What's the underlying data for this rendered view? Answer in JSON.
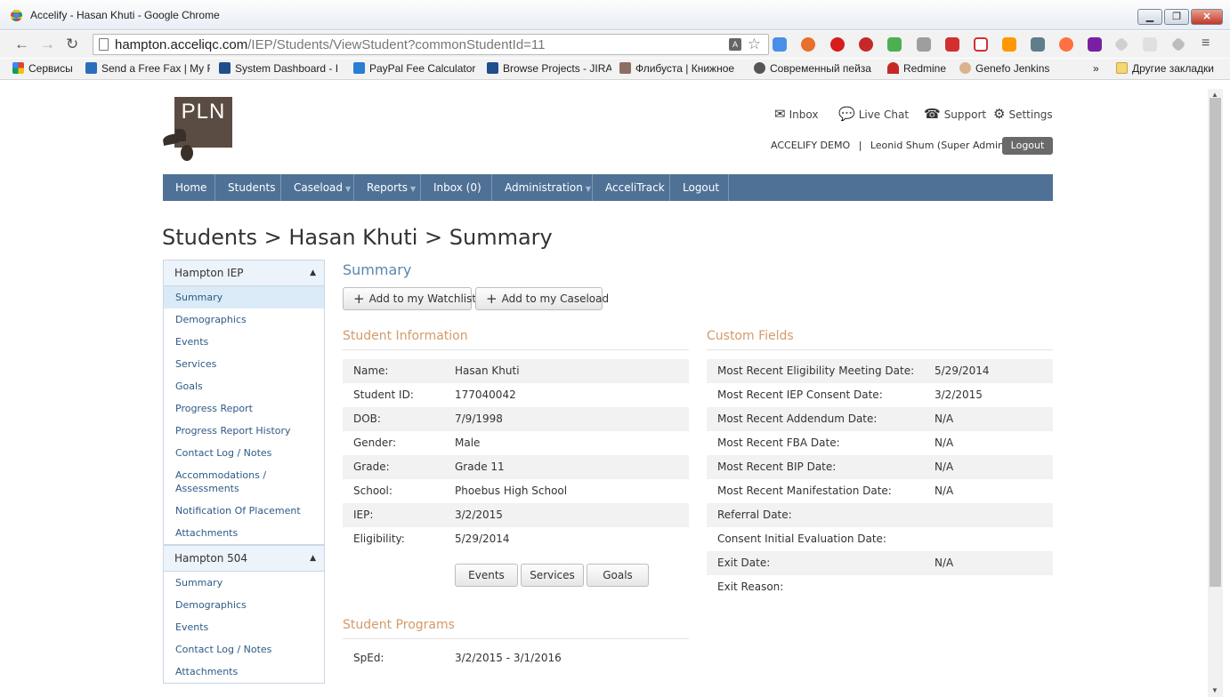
{
  "window": {
    "title": "Accelify - Hasan Khuti - Google Chrome",
    "minimize_label": "▁",
    "restore_label": "❐",
    "close_label": "✕"
  },
  "toolbar": {
    "url_host": "hampton.acceliqc.com",
    "url_path": "/IEP/Students/ViewStudent?commonStudentId=11"
  },
  "bookmarks": [
    {
      "label": "Сервисы"
    },
    {
      "label": "Send a Free Fax | My F"
    },
    {
      "label": "System Dashboard - I"
    },
    {
      "label": "PayPal Fee Calculator"
    },
    {
      "label": "Browse Projects - JIRA"
    },
    {
      "label": "Флибуста | Книжное"
    },
    {
      "label": "Современный пейза"
    },
    {
      "label": "Redmine"
    },
    {
      "label": "Genefo Jenkins"
    },
    {
      "label": "»"
    },
    {
      "label": "Другие закладки"
    }
  ],
  "header": {
    "logo_text": "PLN",
    "inbox": "Inbox",
    "live_chat": "Live Chat",
    "support": "Support",
    "settings": "Settings",
    "org": "ACCELIFY DEMO",
    "separator": "|",
    "user": "Leonid Shum (Super Admin Plus)",
    "logout": "Logout"
  },
  "nav": {
    "home": "Home",
    "students": "Students",
    "caseload": "Caseload",
    "reports": "Reports",
    "inbox": "Inbox (0)",
    "administration": "Administration",
    "accelitrack": "AcceliTrack",
    "logout": "Logout"
  },
  "breadcrumb": "Students > Hasan Khuti > Summary",
  "sidebar": {
    "group1": {
      "title": "Hampton IEP",
      "items": [
        "Summary",
        "Demographics",
        "Events",
        "Services",
        "Goals",
        "Progress Report",
        "Progress Report History",
        "Contact Log / Notes",
        "Accommodations / Assessments",
        "Notification Of Placement",
        "Attachments"
      ]
    },
    "group2": {
      "title": "Hampton 504",
      "items": [
        "Summary",
        "Demographics",
        "Events",
        "Contact Log / Notes",
        "Attachments"
      ]
    }
  },
  "main": {
    "title": "Summary",
    "watchlist_btn": "Add to my Watchlist",
    "caseload_btn": "Add to my Caseload",
    "student_info_title": "Student Information",
    "student_info": [
      {
        "label": "Name:",
        "value": "Hasan Khuti"
      },
      {
        "label": "Student ID:",
        "value": "177040042"
      },
      {
        "label": "DOB:",
        "value": "7/9/1998"
      },
      {
        "label": "Gender:",
        "value": "Male"
      },
      {
        "label": "Grade:",
        "value": "Grade 11"
      },
      {
        "label": "School:",
        "value": "Phoebus High School"
      },
      {
        "label": "IEP:",
        "value": "3/2/2015"
      },
      {
        "label": "Eligibility:",
        "value": "5/29/2014"
      }
    ],
    "events_btn": "Events",
    "services_btn": "Services",
    "goals_btn": "Goals",
    "custom_fields_title": "Custom Fields",
    "custom_fields": [
      {
        "label": "Most Recent Eligibility Meeting Date:",
        "value": "5/29/2014"
      },
      {
        "label": "Most Recent IEP Consent Date:",
        "value": "3/2/2015"
      },
      {
        "label": "Most Recent Addendum Date:",
        "value": "N/A"
      },
      {
        "label": "Most Recent FBA Date:",
        "value": "N/A"
      },
      {
        "label": "Most Recent BIP Date:",
        "value": "N/A"
      },
      {
        "label": "Most Recent Manifestation Date:",
        "value": "N/A"
      },
      {
        "label": "Referral Date:",
        "value": ""
      },
      {
        "label": "Consent Initial Evaluation Date:",
        "value": ""
      },
      {
        "label": "Exit Date:",
        "value": "N/A"
      },
      {
        "label": "Exit Reason:",
        "value": ""
      }
    ],
    "programs_title": "Student Programs",
    "programs": [
      {
        "label": "SpEd:",
        "value": "3/2/2015 - 3/1/2016"
      }
    ]
  }
}
